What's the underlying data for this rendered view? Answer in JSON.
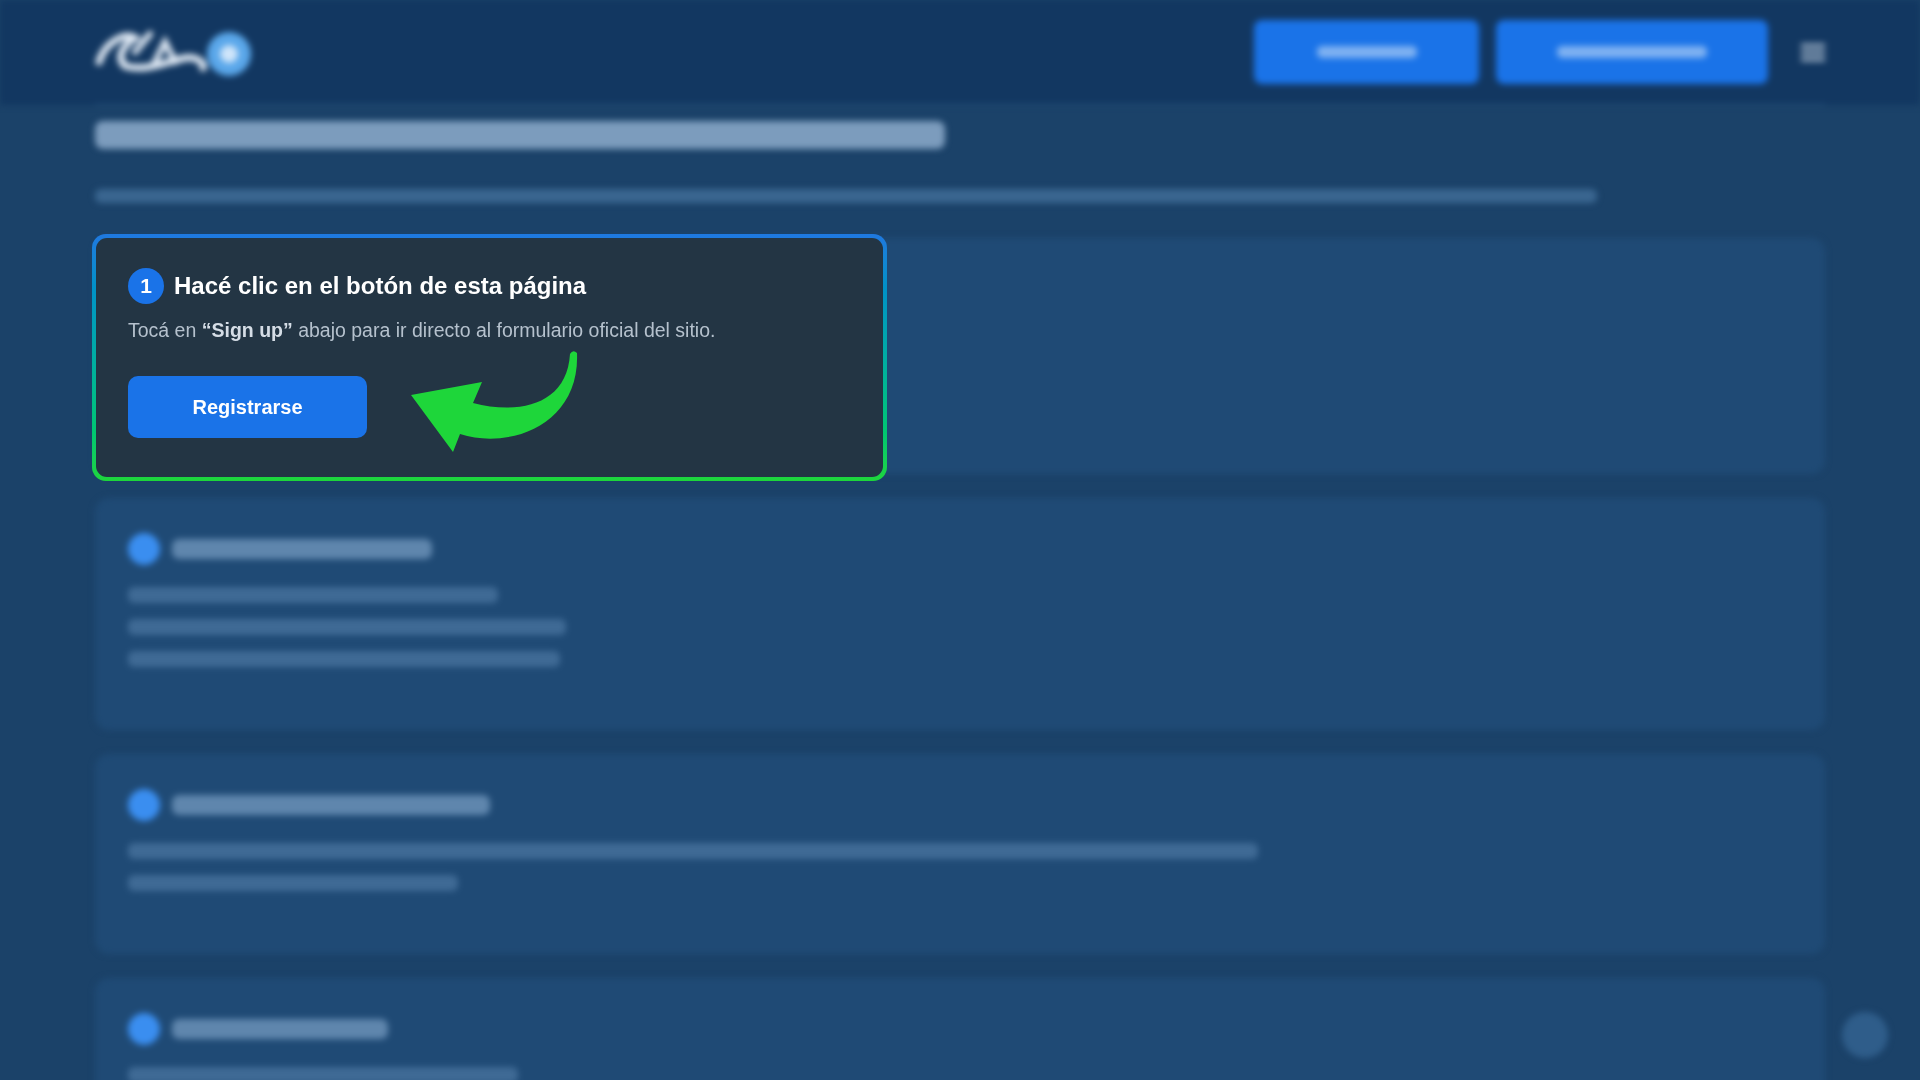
{
  "steps": [
    {
      "number": "1",
      "title": "Hacé clic en el botón de esta página",
      "text": "Tocá en **“Sign up”** abajo para ir directo al formulario oficial del sitio.",
      "button": "Registrarse",
      "highlighted": true
    },
    {
      "highlighted": false
    },
    {
      "highlighted": false
    },
    {
      "highlighted": false
    }
  ]
}
